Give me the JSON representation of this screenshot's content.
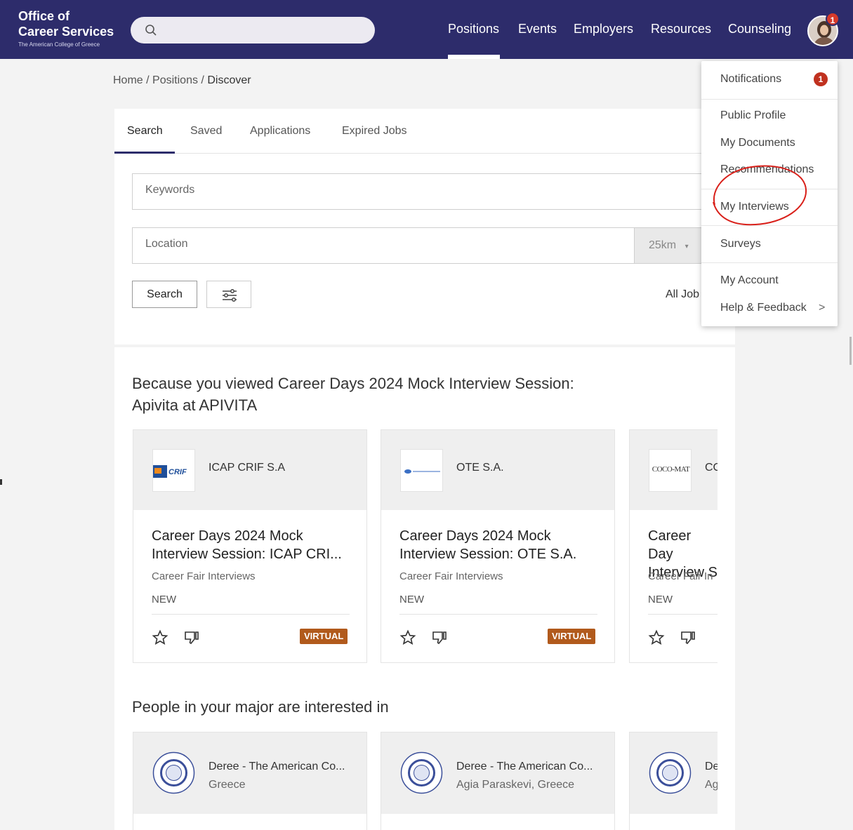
{
  "brand": {
    "line1": "Office of",
    "line2": "Career Services",
    "line3": "The American College of Greece"
  },
  "search": {
    "placeholder": ""
  },
  "nav": [
    "Positions",
    "Events",
    "Employers",
    "Resources",
    "Counseling"
  ],
  "avatar_badge": "1",
  "breadcrumb": {
    "home": "Home",
    "sep": "/",
    "positions": "Positions",
    "current": "Discover"
  },
  "tabs": [
    "Search",
    "Saved",
    "Applications",
    "Expired Jobs"
  ],
  "form": {
    "keywords_placeholder": "Keywords",
    "location_placeholder": "Location",
    "distance": "25km",
    "search_button": "Search",
    "all_jobs": "All Job"
  },
  "section1": {
    "title": "Because you viewed Career Days 2024 Mock Interview Session: Apivita at APIVITA",
    "cards": [
      {
        "org": "ICAP CRIF S.A",
        "title": "Career Days 2024 Mock Interview Session: ICAP CRI...",
        "type": "Career Fair Interviews",
        "status": "NEW",
        "badge": "VIRTUAL"
      },
      {
        "org": "OTE S.A.",
        "title": "Career Days 2024 Mock Interview Session: OTE S.A.",
        "type": "Career Fair Interviews",
        "status": "NEW",
        "badge": "VIRTUAL"
      },
      {
        "org": "CC",
        "logo_text": "COCO-MAT",
        "title": "Career Day Interview S",
        "type": "Career Fair In",
        "status": "NEW",
        "badge": ""
      }
    ]
  },
  "section2": {
    "title": "People in your major are interested in",
    "cards": [
      {
        "org": "Deree - The American Co...",
        "location": "Greece"
      },
      {
        "org": "Deree - The American Co...",
        "location": "Agia Paraskevi, Greece"
      },
      {
        "org": "De",
        "location": "Ag"
      }
    ]
  },
  "dropdown": {
    "notifications": "Notifications",
    "notifications_count": "1",
    "public_profile": "Public Profile",
    "my_documents": "My Documents",
    "recommendations": "Recommendations",
    "my_interviews": "My Interviews",
    "surveys": "Surveys",
    "my_account": "My Account",
    "help_feedback": "Help & Feedback",
    "chevron": ">"
  },
  "colors": {
    "nav_bg": "#2d2c6b",
    "badge_red": "#c0311f",
    "virtual_badge": "#b15a1c",
    "annotation": "#d9201a"
  }
}
